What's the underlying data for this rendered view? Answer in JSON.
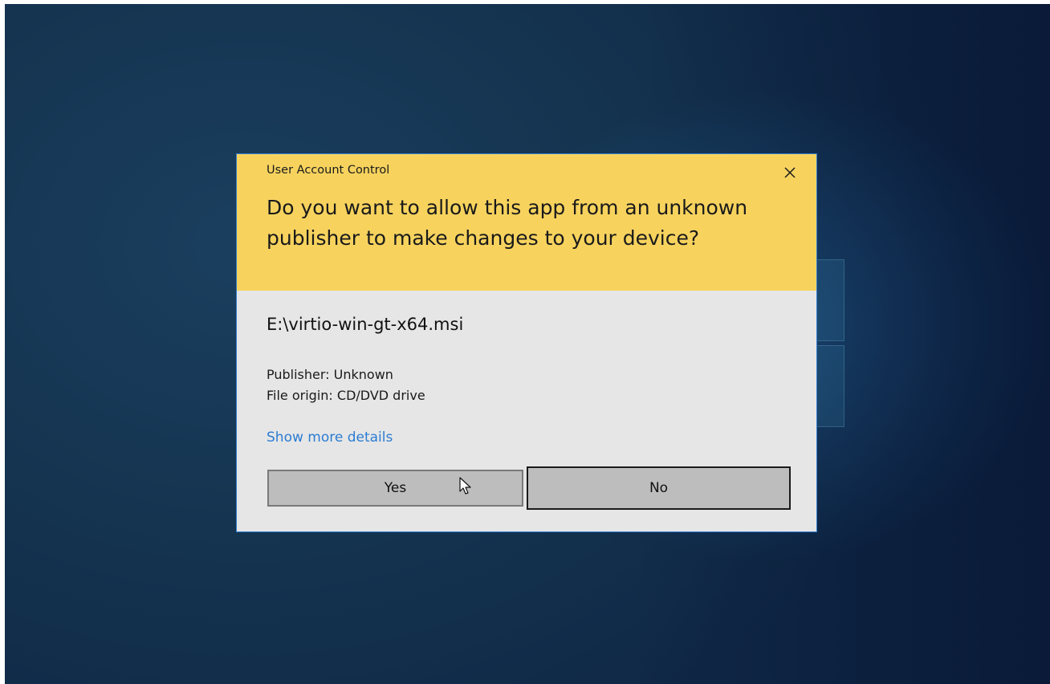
{
  "dialog": {
    "title": "User Account Control",
    "question": "Do you want to allow this app from an unknown publisher to make changes to your device?",
    "app_path": "E:\\virtio-win-gt-x64.msi",
    "publisher": "Publisher: Unknown",
    "file_origin": "File origin: CD/DVD drive",
    "details_link": "Show more details",
    "yes_label": "Yes",
    "no_label": "No"
  },
  "icons": {
    "close": "close-icon",
    "cursor": "mouse-pointer-icon"
  },
  "colors": {
    "header": "#f7d35e",
    "body": "#e6e6e6",
    "link": "#2b7cd3",
    "border": "#2f7bcf",
    "desktop": "#14334f"
  }
}
